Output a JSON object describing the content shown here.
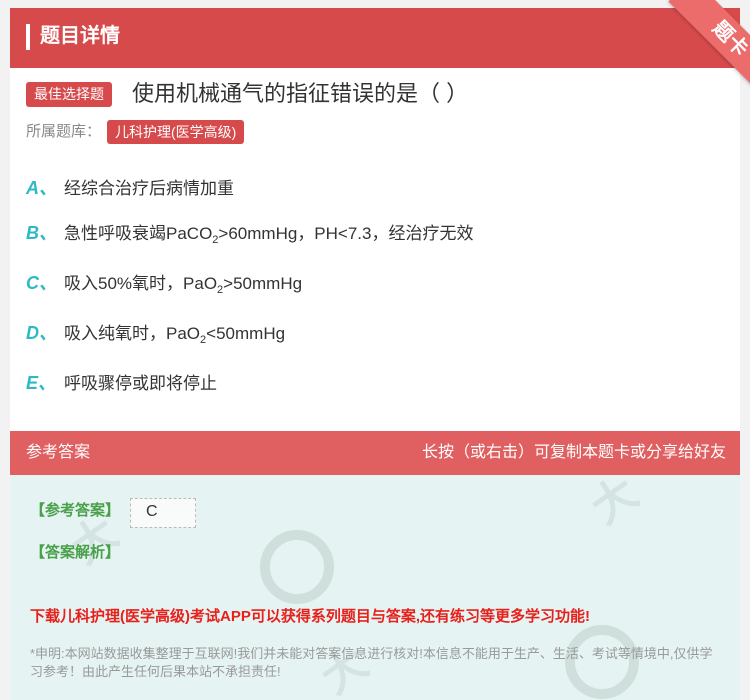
{
  "header": {
    "title": "题目详情",
    "corner_tag": "题卡"
  },
  "question": {
    "type_tag": "最佳选择题",
    "text": "使用机械通气的指征错误的是（ ）",
    "library_label": "所属题库：",
    "library_name": "儿科护理(医学高级)"
  },
  "options": [
    {
      "letter": "A、",
      "text": "经综合治疗后病情加重"
    },
    {
      "letter": "B、",
      "text_before": "急性呼吸衰竭PaCO",
      "sub": "2",
      "text_after": ">60mmHg，PH<7.3，经治疗无效"
    },
    {
      "letter": "C、",
      "text_before": "吸入50%氧时，PaO",
      "sub": "2",
      "text_after": ">50mmHg"
    },
    {
      "letter": "D、",
      "text_before": "吸入纯氧时，PaO",
      "sub": "2",
      "text_after": "<50mmHg"
    },
    {
      "letter": "E、",
      "text": "呼吸骤停或即将停止"
    }
  ],
  "answer_section": {
    "title": "参考答案",
    "hint": "长按（或右击）可复制本题卡或分享给好友",
    "answer_label": "【参考答案】",
    "answer_value": "C",
    "analysis_label": "【答案解析】",
    "promo": "下载儿科护理(医学高级)考试APP可以获得系列题目与答案,还有练习等更多学习功能!",
    "disclaimer": "*申明:本网站数据收集整理于互联网!我们并未能对答案信息进行核对!本信息不能用于生产、生活、考试等情境中,仅供学习参考！由此产生任何后果本站不承担责任!"
  },
  "colors": {
    "brand_red": "#d64a4c",
    "option_letter": "#2db9c4",
    "answer_bg": "#e5f4f2",
    "promo_red": "#e8201c"
  }
}
